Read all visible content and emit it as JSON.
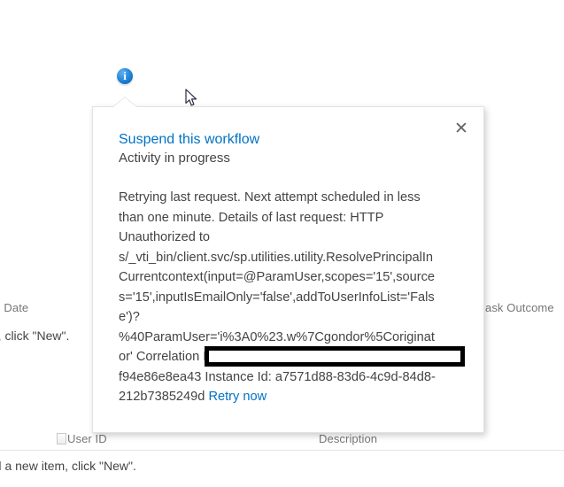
{
  "background": {
    "columns": {
      "due_date": "ue Date",
      "task_outcome": "ask Outcome",
      "user_id": "User ID",
      "description": "Description"
    },
    "hints": {
      "top": "m, click \"New\".",
      "bottom": "dd a new item, click \"New\"."
    }
  },
  "info_icon": {
    "glyph": "i",
    "name": "information-icon"
  },
  "popup": {
    "title": "Suspend this workflow",
    "subtitle": "Activity in progress",
    "close_label": "✕",
    "message_part_1": "Retrying last request. Next attempt scheduled in less than one minute. Details of last request: HTTP Unauthorized to ",
    "message_part_2": "s/_vti_bin/client.svc/sp.utilities.utility.ResolvePrincipalInCurrentcontext(input=@ParamUser,scopes='15',sources='15',inputIsEmailOnly='false',addToUserInfoList='False')?%40ParamUser='i%3A0%23.w%7Cgondor%5Coriginator' Correlation Id: 95e9e150-afe1-3a4c-a634-f94e86e8ea43 Instance Id: a7571d88-83d6-4c9d-84d8-212b7385249d ",
    "retry_link": "Retry now",
    "redacted_text": ""
  },
  "colors": {
    "link": "#0072c6",
    "text": "#444444",
    "muted": "#767676",
    "redaction": "#000000",
    "info_icon": "#0f6cbd"
  }
}
